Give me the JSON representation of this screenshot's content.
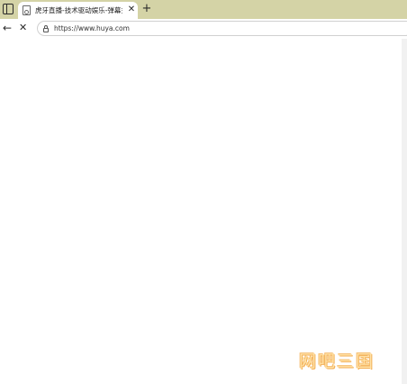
{
  "tabstrip": {
    "tab_actions_icon": "tab-actions-icon",
    "active_tab": {
      "favicon": "page-icon",
      "title": "虎牙直播-技术驱动娱乐-弹幕式互",
      "close_icon": "close-icon"
    },
    "new_tab_icon": "plus-icon",
    "background_color": "#d4d3a6"
  },
  "toolbar": {
    "back_icon": "arrow-left-icon",
    "stop_icon": "close-icon",
    "address": {
      "security_icon": "lock-icon",
      "url": "https://www.huya.com"
    }
  },
  "page": {
    "background_color": "#ffffff"
  },
  "watermark": {
    "text": "网吧三国",
    "color": "#f1a23a"
  }
}
